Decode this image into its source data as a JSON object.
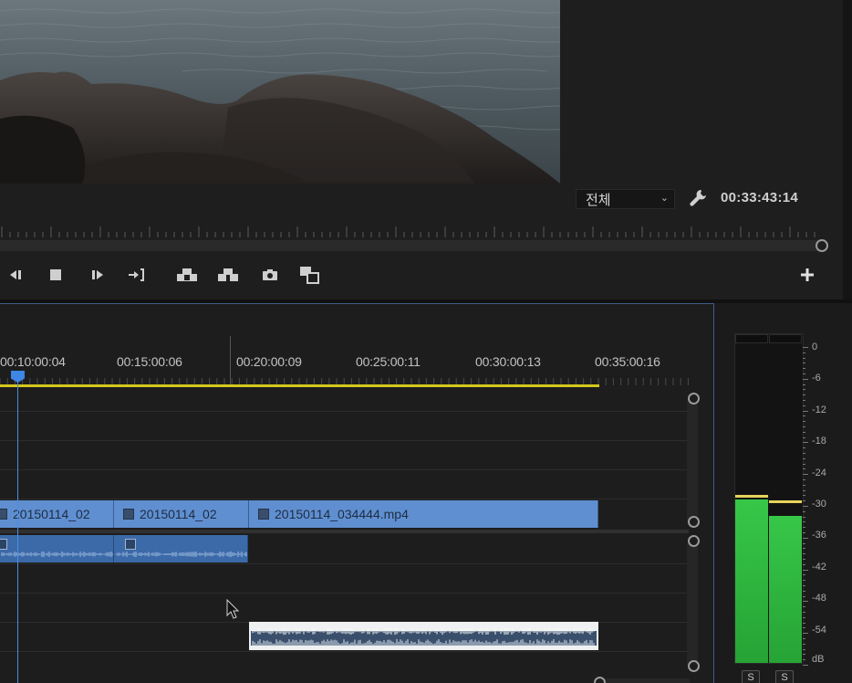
{
  "program_monitor": {
    "zoom_level": "전체",
    "timecode": "00:33:43:14"
  },
  "playback_controls": [
    {
      "icon": "step-back-icon"
    },
    {
      "icon": "stop-icon"
    },
    {
      "icon": "step-forward-icon"
    },
    {
      "icon": "go-to-out-icon"
    },
    {
      "icon": "lift-icon"
    },
    {
      "icon": "extract-icon"
    },
    {
      "icon": "export-frame-icon"
    },
    {
      "icon": "comparison-view-icon"
    },
    {
      "icon": "add-button-icon"
    }
  ],
  "timeline": {
    "ruler_labels": [
      "00:10:00:04",
      "00:15:00:06",
      "00:20:00:09",
      "00:25:00:11",
      "00:30:00:13",
      "00:35:00:16"
    ],
    "video_clips": [
      {
        "name": "20150114_02"
      },
      {
        "name": "20150114_02"
      },
      {
        "name": "20150114_034444.mp4"
      }
    ],
    "colors": {
      "video_clip": "#5f8fd0",
      "audio_clip": "#3c6aa8",
      "playhead": "#3d86e6",
      "work_area": "#d4c81c"
    }
  },
  "audio_meter": {
    "scale_labels": [
      "0",
      "-6",
      "-12",
      "-18",
      "-24",
      "-30",
      "-36",
      "-42",
      "-48",
      "-54",
      "dB"
    ],
    "channels": [
      {
        "level_db": -29,
        "peak_db": -28.5,
        "solo_label": "S"
      },
      {
        "level_db": -32,
        "peak_db": -29.5,
        "solo_label": "S"
      }
    ],
    "colors": {
      "level": "#37c748",
      "peak_left": "#e6d35a",
      "peak_right": "#e6d35a"
    }
  }
}
